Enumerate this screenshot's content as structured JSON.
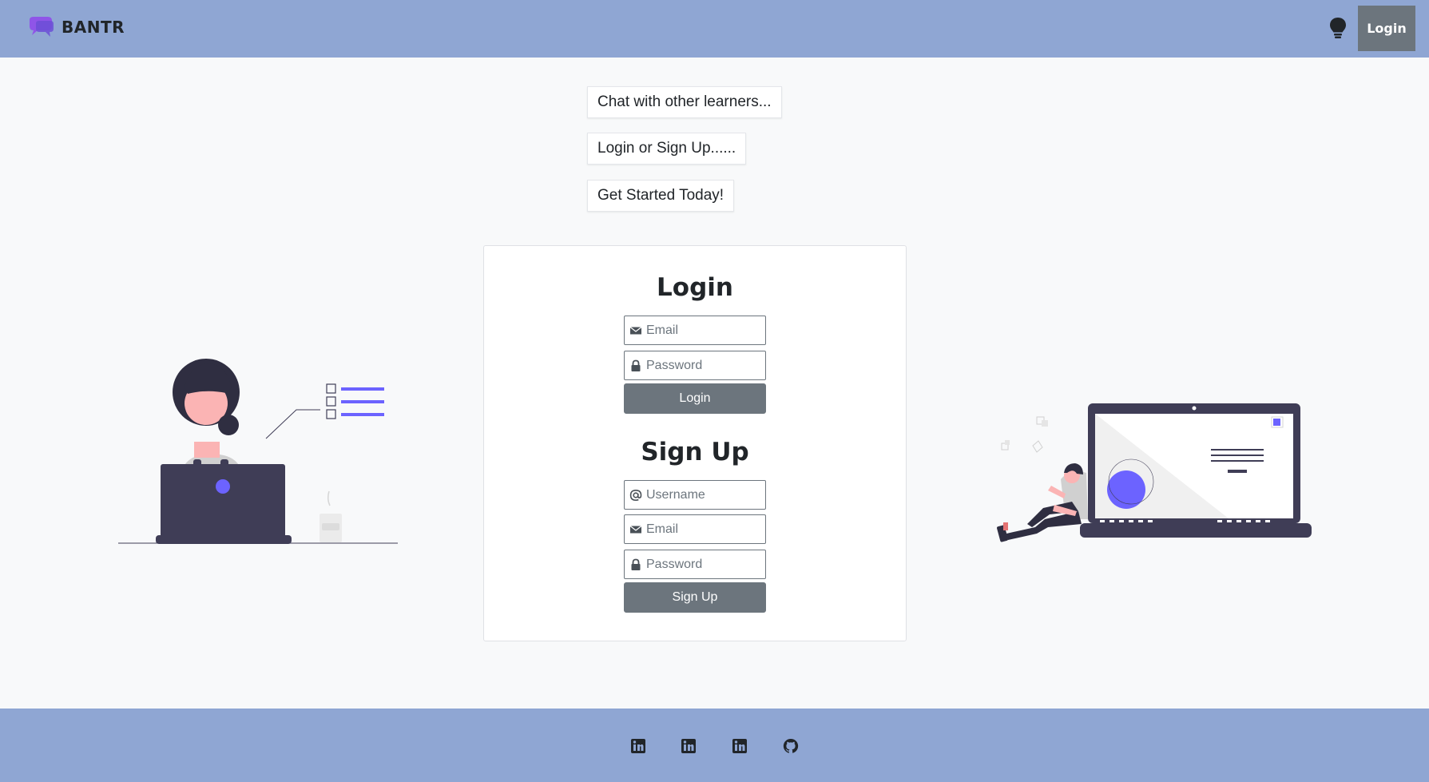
{
  "navbar": {
    "brand": "BANTR",
    "login_label": "Login",
    "icons": {
      "brand": "chat-bubbles-logo-icon",
      "theme": "lightbulb-icon"
    }
  },
  "taglines": [
    "Chat with other learners...",
    "Login or Sign Up......",
    "Get Started Today!"
  ],
  "login_form": {
    "title": "Login",
    "email_placeholder": "Email",
    "password_placeholder": "Password",
    "submit_label": "Login"
  },
  "signup_form": {
    "title": "Sign Up",
    "username_placeholder": "Username",
    "email_placeholder": "Email",
    "password_placeholder": "Password",
    "submit_label": "Sign Up"
  },
  "footer": {
    "links": [
      "linkedin-icon",
      "linkedin-icon",
      "linkedin-icon",
      "github-icon"
    ]
  },
  "colors": {
    "navbar_bg": "#8fa6d3",
    "button_bg": "#6c757d",
    "accent_purple": "#6c63ff",
    "page_bg": "#f8f9fa"
  }
}
